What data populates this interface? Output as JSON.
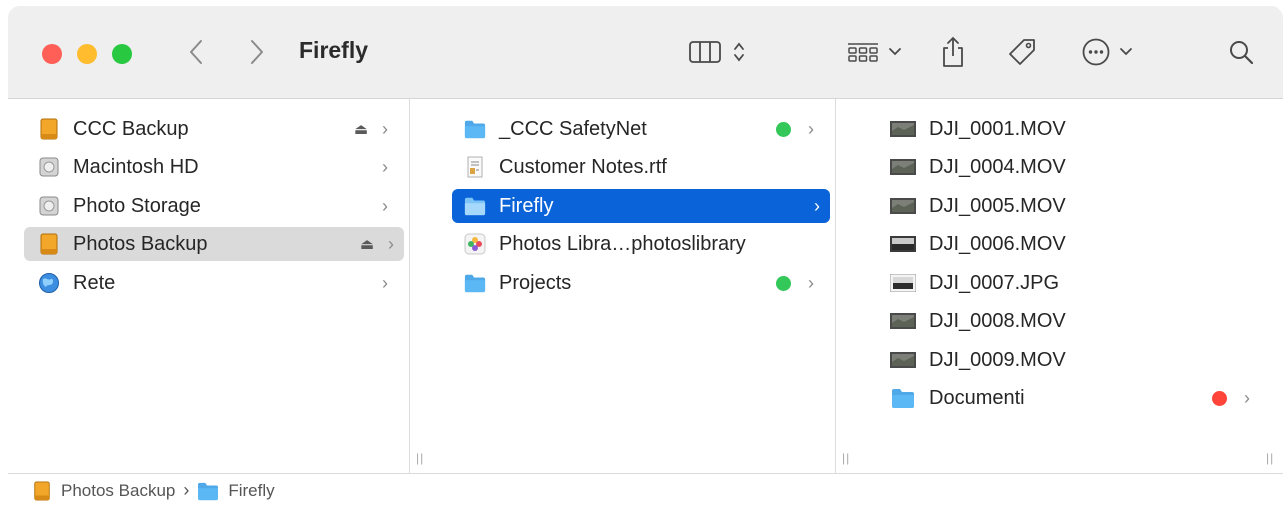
{
  "window": {
    "title": "Firefly"
  },
  "toolbar": {
    "back_icon": "chevron-left-icon",
    "forward_icon": "chevron-right-icon",
    "view_icon": "column-view-icon",
    "group_icon": "group-icon",
    "share_icon": "share-icon",
    "tag_icon": "tag-icon",
    "more_icon": "ellipsis-circle-icon",
    "search_icon": "search-icon"
  },
  "sidebar": {
    "items": [
      {
        "label": "CCC Backup",
        "icon": "external-drive-icon",
        "eject": "⏏"
      },
      {
        "label": "Macintosh HD",
        "icon": "internal-drive-icon"
      },
      {
        "label": "Photo Storage",
        "icon": "internal-drive-icon"
      },
      {
        "label": "Photos Backup",
        "icon": "external-drive-icon",
        "eject": "⏏"
      },
      {
        "label": "Rete",
        "icon": "network-globe-icon"
      }
    ]
  },
  "column2": {
    "items": [
      {
        "label": "_CCC SafetyNet",
        "icon": "folder-icon",
        "tag": "#34c759"
      },
      {
        "label": "Customer Notes.rtf",
        "icon": "rtf-file-icon"
      },
      {
        "label": "Firefly",
        "icon": "folder-icon"
      },
      {
        "label": "Photos Libra…photoslibrary",
        "icon": "photos-library-icon"
      },
      {
        "label": "Projects",
        "icon": "folder-icon",
        "tag": "#34c759"
      }
    ]
  },
  "column3": {
    "items": [
      {
        "label": "DJI_0001.MOV",
        "icon": "video-thumbnail-icon"
      },
      {
        "label": "DJI_0004.MOV",
        "icon": "video-thumbnail-icon"
      },
      {
        "label": "DJI_0005.MOV",
        "icon": "video-thumbnail-icon"
      },
      {
        "label": "DJI_0006.MOV",
        "icon": "video-thumbnail-icon"
      },
      {
        "label": "DJI_0007.JPG",
        "icon": "image-thumbnail-icon"
      },
      {
        "label": "DJI_0008.MOV",
        "icon": "video-thumbnail-icon"
      },
      {
        "label": "DJI_0009.MOV",
        "icon": "video-thumbnail-icon"
      },
      {
        "label": "Documenti",
        "icon": "folder-icon",
        "tag": "#ff453a"
      }
    ]
  },
  "pathbar": {
    "items": [
      {
        "label": "Photos Backup",
        "icon": "external-drive-icon"
      },
      {
        "label": "Firefly",
        "icon": "folder-icon"
      }
    ],
    "separator": "›"
  },
  "chevron": "›",
  "resize_handle": "||",
  "colors": {
    "selection_blue": "#0a63d8",
    "selection_gray": "#dadada",
    "folder_blue": "#4fa8e8",
    "tag_green": "#34c759",
    "tag_red": "#ff453a"
  }
}
